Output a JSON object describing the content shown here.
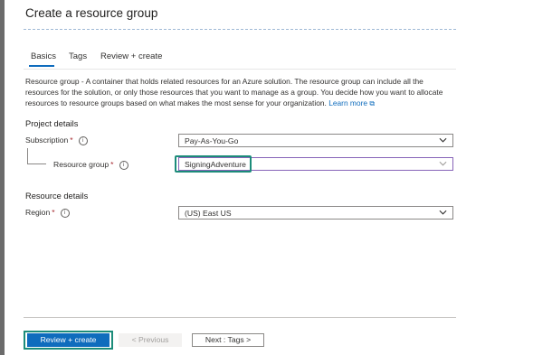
{
  "header": {
    "title": "Create a resource group"
  },
  "tabs": [
    {
      "label": "Basics",
      "selected": true
    },
    {
      "label": "Tags",
      "selected": false
    },
    {
      "label": "Review + create",
      "selected": false
    }
  ],
  "description": {
    "term": "Resource group",
    "text": " - A container that holds related resources for an Azure solution. The resource group can include all the resources for the solution, or only those resources that you want to manage as a group. You decide how you want to allocate resources to resource groups based on what makes the most sense for your organization.",
    "link": "Learn more",
    "link_icon": "external-link-icon"
  },
  "project_details": {
    "heading": "Project details",
    "subscription": {
      "label": "Subscription",
      "required": "*",
      "value": "Pay-As-You-Go"
    },
    "resource_group": {
      "label": "Resource group",
      "required": "*",
      "value": "SigningAdventure"
    }
  },
  "resource_details": {
    "heading": "Resource details",
    "region": {
      "label": "Region",
      "required": "*",
      "value": "(US) East US"
    }
  },
  "footer": {
    "review_create": "Review + create",
    "previous": "< Previous",
    "next": "Next : Tags >"
  },
  "colors": {
    "accent": "#0f6cbd",
    "highlight": "#1c8c7a",
    "focus_border": "#8764b8",
    "required": "#a4262c"
  }
}
